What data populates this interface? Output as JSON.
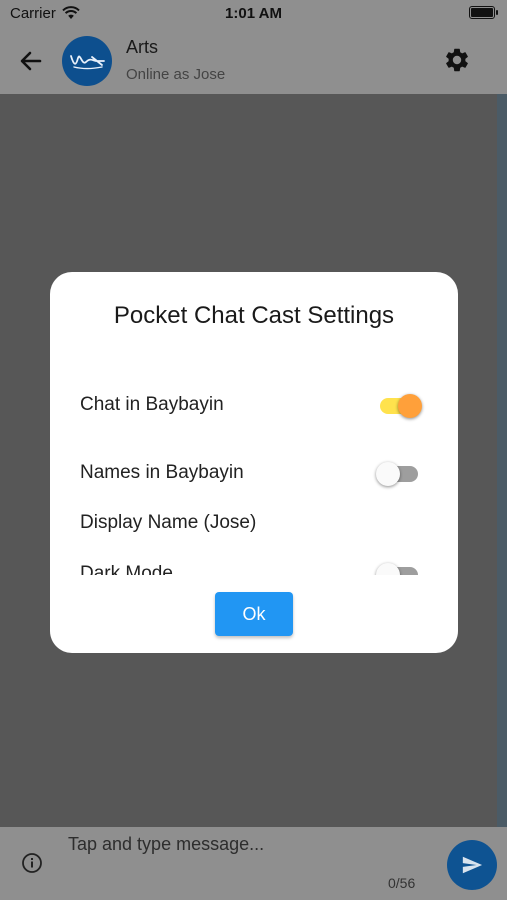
{
  "status_bar": {
    "carrier": "Carrier",
    "time": "1:01 AM"
  },
  "app_bar": {
    "title": "Arts",
    "subtitle": "Online as Jose"
  },
  "modal": {
    "title": "Pocket Chat Cast Settings",
    "settings": [
      {
        "label": "Chat in Baybayin",
        "enabled": true
      },
      {
        "label": "Names in Baybayin",
        "enabled": false
      },
      {
        "label": "Display Name (Jose)"
      },
      {
        "label": "Dark Mode",
        "enabled": false
      }
    ],
    "ok_label": "Ok"
  },
  "composer": {
    "placeholder": "Tap and type message...",
    "counter": "0/56"
  },
  "colors": {
    "accent_blue": "#2196f3",
    "toggle_on_thumb": "#ffa03a",
    "toggle_on_track": "#ffe24d",
    "avatar": "#0d4f8e"
  },
  "icons": {
    "back": "arrow-left-icon",
    "settings": "gear-icon",
    "info": "info-icon",
    "send": "send-icon",
    "wifi": "wifi-icon",
    "battery": "battery-icon"
  }
}
